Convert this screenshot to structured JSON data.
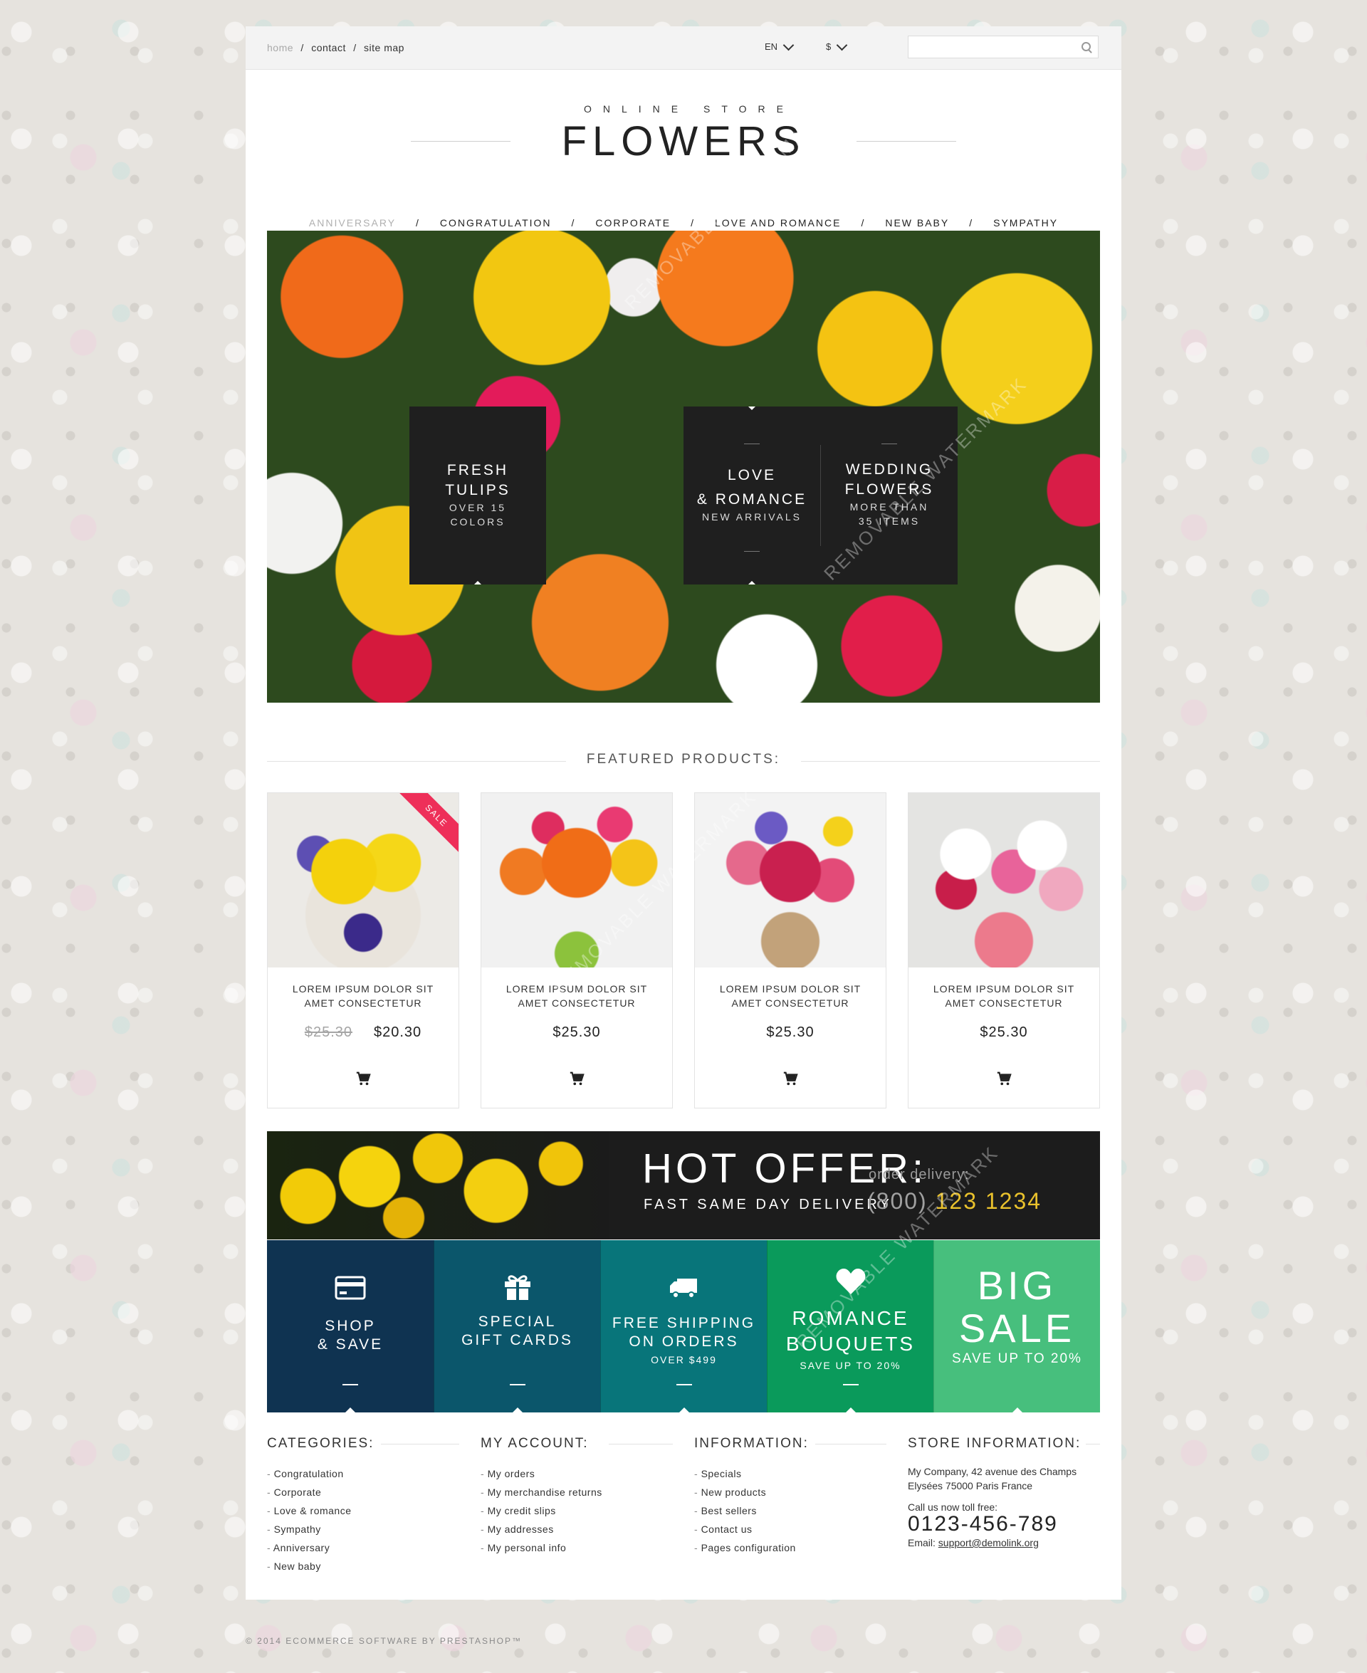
{
  "topbar": {
    "breadcrumb": [
      "home",
      "contact",
      "site map"
    ],
    "language": "EN",
    "currency": "$",
    "search_placeholder": ""
  },
  "logo": {
    "subtitle": "ONLINE STORE",
    "title": "FLOWERS"
  },
  "nav": [
    "ANNIVERSARY",
    "CONGRATULATION",
    "CORPORATE",
    "LOVE AND ROMANCE",
    "NEW BABY",
    "SYMPATHY"
  ],
  "hero": {
    "blocks": [
      {
        "title_lines": [
          "FRESH",
          "TULIPS"
        ],
        "sub_lines": [
          "OVER 15",
          "COLORS"
        ]
      },
      {
        "title_lines": [
          "LOVE",
          "& ROMANCE"
        ],
        "sub_lines": [
          "NEW ARRIVALS"
        ]
      },
      {
        "title_lines": [
          "WEDDING",
          "FLOWERS"
        ],
        "sub_lines": [
          "MORE THAN",
          "35 ITEMS"
        ]
      }
    ]
  },
  "featured": {
    "title": "FEATURED PRODUCTS:",
    "products": [
      {
        "name_lines": [
          "LOREM IPSUM DOLOR SIT",
          "AMET CONSECTETUR"
        ],
        "old_price": "$25.30",
        "price": "$20.30",
        "badge": "SALE"
      },
      {
        "name_lines": [
          "LOREM IPSUM DOLOR SIT",
          "AMET CONSECTETUR"
        ],
        "old_price": "",
        "price": "$25.30",
        "badge": ""
      },
      {
        "name_lines": [
          "LOREM IPSUM DOLOR SIT",
          "AMET CONSECTETUR"
        ],
        "old_price": "",
        "price": "$25.30",
        "badge": ""
      },
      {
        "name_lines": [
          "LOREM IPSUM DOLOR SIT",
          "AMET CONSECTETUR"
        ],
        "old_price": "",
        "price": "$25.30",
        "badge": ""
      }
    ]
  },
  "hot_offer": {
    "title": "HOT OFFER:",
    "subtitle": "FAST SAME DAY DELIVERY",
    "order_delivery": "order delivery:",
    "phone_prefix": "(800)",
    "phone_number": "123 1234"
  },
  "promos": [
    {
      "icon": "credit-card-icon",
      "title_lines": [
        "SHOP",
        "& SAVE"
      ],
      "sub": "",
      "color": "#0f3351"
    },
    {
      "icon": "gift-icon",
      "title_lines": [
        "SPECIAL",
        "GIFT CARDS"
      ],
      "sub": "",
      "color": "#0b566b"
    },
    {
      "icon": "truck-icon",
      "title_lines": [
        "FREE SHIPPING",
        "ON ORDERS"
      ],
      "sub": "OVER $499",
      "color": "#08757a"
    },
    {
      "icon": "heart-icon",
      "title_lines": [
        "ROMANCE",
        "BOUQUETS"
      ],
      "sub": "SAVE UP TO 20%",
      "color": "#0a9a5b"
    },
    {
      "icon": "",
      "title_lines": [
        "BIG",
        "SALE"
      ],
      "sub": "SAVE UP TO 20%",
      "color": "#47bf7d"
    }
  ],
  "footer": {
    "categories": {
      "title": "CATEGORIES:",
      "items": [
        "Congratulation",
        "Corporate",
        "Love & romance",
        "Sympathy",
        "Anniversary",
        "New baby"
      ]
    },
    "account": {
      "title": "MY ACCOUNT:",
      "items": [
        "My orders",
        "My merchandise returns",
        "My credit slips",
        "My addresses",
        "My personal info"
      ]
    },
    "information": {
      "title": "INFORMATION:",
      "items": [
        "Specials",
        "New products",
        "Best sellers",
        "Contact us",
        "Pages configuration"
      ]
    },
    "store": {
      "title": "STORE INFORMATION:",
      "address_line1": "My Company, 42 avenue des Champs",
      "address_line2": "Elysées 75000 Paris France",
      "call_label": "Call us now toll free:",
      "phone": "0123-456-789",
      "email_label": "Email:",
      "email": "support@demolink.org"
    }
  },
  "copyright": "© 2014 ECOMMERCE SOFTWARE BY PRESTASHOP™",
  "watermark": "REMOVABLE WATERMARK"
}
